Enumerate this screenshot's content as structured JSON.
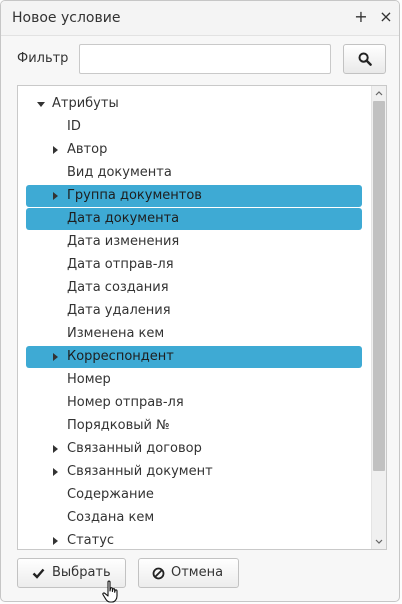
{
  "dialog": {
    "title": "Новое условие",
    "maximize_symbol": "+",
    "close_symbol": "×"
  },
  "filter": {
    "label": "Фильтр",
    "value": "",
    "placeholder": "",
    "search_icon": "search-icon"
  },
  "tree": {
    "items": [
      {
        "label": "Атрибуты",
        "expander": "expanded",
        "selected": false
      },
      {
        "label": "ID",
        "expander": "none",
        "selected": false
      },
      {
        "label": "Автор",
        "expander": "collapsed",
        "selected": false
      },
      {
        "label": "Вид документа",
        "expander": "none",
        "selected": false
      },
      {
        "label": "Группа документов",
        "expander": "collapsed",
        "selected": true
      },
      {
        "label": "Дата документа",
        "expander": "none",
        "selected": true
      },
      {
        "label": "Дата изменения",
        "expander": "none",
        "selected": false
      },
      {
        "label": "Дата отправ-ля",
        "expander": "none",
        "selected": false
      },
      {
        "label": "Дата создания",
        "expander": "none",
        "selected": false
      },
      {
        "label": "Дата удаления",
        "expander": "none",
        "selected": false
      },
      {
        "label": "Изменена кем",
        "expander": "none",
        "selected": false
      },
      {
        "label": "Корреспондент",
        "expander": "collapsed",
        "selected": true
      },
      {
        "label": "Номер",
        "expander": "none",
        "selected": false
      },
      {
        "label": "Номер отправ-ля",
        "expander": "none",
        "selected": false
      },
      {
        "label": "Порядковый №",
        "expander": "none",
        "selected": false
      },
      {
        "label": "Связанный договор",
        "expander": "collapsed",
        "selected": false
      },
      {
        "label": "Связанный документ",
        "expander": "collapsed",
        "selected": false
      },
      {
        "label": "Содержание",
        "expander": "none",
        "selected": false
      },
      {
        "label": "Создана кем",
        "expander": "none",
        "selected": false
      },
      {
        "label": "Статус",
        "expander": "collapsed",
        "selected": false
      }
    ],
    "selection_color": "#3eaad4"
  },
  "buttons": {
    "select_label": "Выбрать",
    "select_icon": "check-icon",
    "cancel_label": "Отмена",
    "cancel_icon": "ban-icon"
  }
}
